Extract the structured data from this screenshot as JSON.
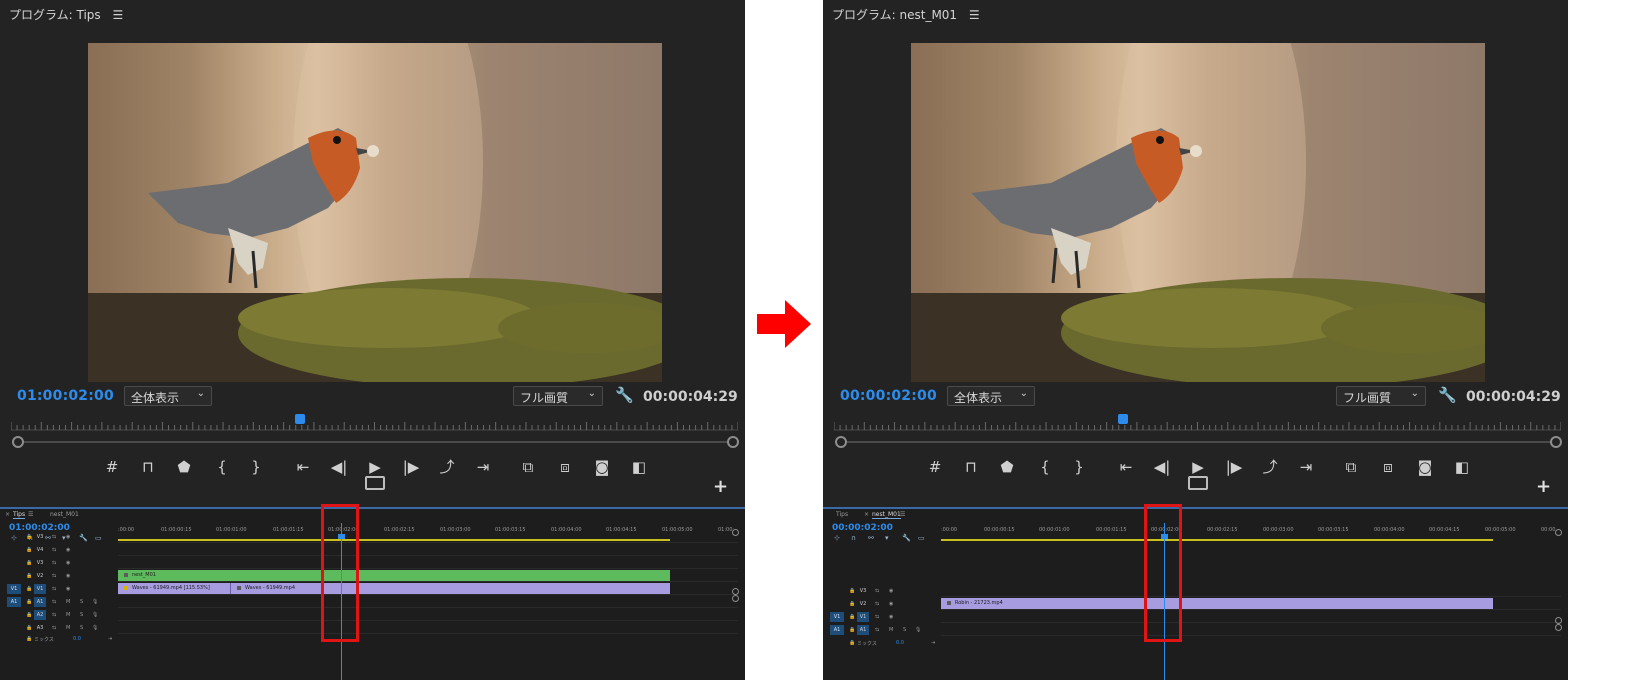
{
  "left_panel": {
    "monitor_title": "プログラム: Tips",
    "current_timecode": "01:00:02:00",
    "zoom_dropdown": "全体表示",
    "quality_dropdown": "フル画質",
    "duration_timecode": "00:00:04:29",
    "timeline": {
      "tabs": [
        "Tips",
        "nest_M01"
      ],
      "active_tab": "Tips",
      "timecode": "01:00:02:00",
      "ruler_labels": [
        ":00:00",
        "01:00:00:15",
        "01:00:01:00",
        "01:00:01:15",
        "01:00:02:00",
        "01:00:02:15",
        "01:00:03:00",
        "01:00:03:15",
        "01:00:04:00",
        "01:00:04:15",
        "01:00:05:00",
        "01:00:"
      ],
      "tracks": [
        {
          "source": "",
          "target": "V3"
        },
        {
          "source": "",
          "target": "V4"
        },
        {
          "source": "",
          "target": "V3"
        },
        {
          "source": "",
          "target": "V2"
        },
        {
          "source": "V1",
          "target": "V1"
        },
        {
          "source": "A1",
          "target": "A1"
        },
        {
          "source": "",
          "target": "A2"
        },
        {
          "source": "",
          "target": "A3"
        }
      ],
      "toggle_m": "M",
      "toggle_s": "S",
      "mix_label": "ミックス",
      "mix_value": "0.0",
      "clips": {
        "nest": "nest_M01",
        "video_a": "Waves - 61949.mp4 [115.53%]",
        "video_b": "Waves - 61949.mp4"
      }
    }
  },
  "right_panel": {
    "monitor_title": "プログラム: nest_M01",
    "current_timecode": "00:00:02:00",
    "zoom_dropdown": "全体表示",
    "quality_dropdown": "フル画質",
    "duration_timecode": "00:00:04:29",
    "timeline": {
      "tabs": [
        "Tips",
        "nest_M01"
      ],
      "active_tab": "nest_M01",
      "timecode": "00:00:02:00",
      "ruler_labels": [
        ":00:00",
        "00:00:00:15",
        "00:00:01:00",
        "00:00:01:15",
        "00:00:02:00",
        "00:00:02:15",
        "00:00:03:00",
        "00:00:03:15",
        "00:00:04:00",
        "00:00:04:15",
        "00:00:05:00",
        "00:00"
      ],
      "tracks": [
        {
          "source": "",
          "target": "V3"
        },
        {
          "source": "",
          "target": "V2"
        },
        {
          "source": "V1",
          "target": "V1"
        },
        {
          "source": "A1",
          "target": "A1"
        }
      ],
      "toggle_m": "M",
      "toggle_s": "S",
      "mix_label": "ミックス",
      "mix_value": "0.0",
      "clips": {
        "video": "Robin - 21723.mp4"
      }
    }
  },
  "icons": {
    "menu": "hamburger-menu-icon",
    "wrench": "wrench-icon",
    "add": "add-icon",
    "arrow": "right-arrow-icon"
  },
  "colors": {
    "accent": "#2d8ceb",
    "highlight": "#e01414",
    "nest_clip": "#5dbb5d",
    "video_clip": "#a79ce0",
    "arrow": "#ff0000"
  }
}
